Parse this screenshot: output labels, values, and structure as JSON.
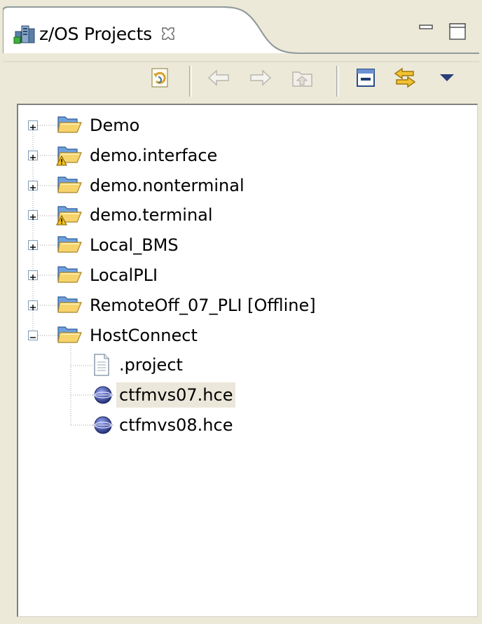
{
  "view": {
    "title": "z/OS Projects",
    "icon": "zos-projects-icon",
    "close_icon": "close-icon",
    "minimize_icon": "minimize-icon",
    "maximize_icon": "maximize-icon"
  },
  "toolbar": {
    "buttons": [
      {
        "name": "refresh-icon"
      },
      {
        "name": "back-arrow-icon",
        "disabled": true
      },
      {
        "name": "forward-arrow-icon",
        "disabled": true
      },
      {
        "name": "up-folder-icon",
        "disabled": true
      },
      {
        "name": "collapse-all-icon"
      },
      {
        "name": "link-with-editor-icon"
      },
      {
        "name": "view-menu-icon"
      }
    ]
  },
  "tree": {
    "items": [
      {
        "label": "Demo",
        "icon": "folder-icon",
        "expanded": false
      },
      {
        "label": "demo.interface",
        "icon": "folder-warning-icon",
        "expanded": false
      },
      {
        "label": "demo.nonterminal",
        "icon": "folder-icon",
        "expanded": false
      },
      {
        "label": "demo.terminal",
        "icon": "folder-warning-icon",
        "expanded": false
      },
      {
        "label": "Local_BMS",
        "icon": "folder-icon",
        "expanded": false
      },
      {
        "label": "LocalPLI",
        "icon": "folder-icon",
        "expanded": false
      },
      {
        "label": "RemoteOff_07_PLI [Offline]",
        "icon": "folder-icon",
        "expanded": false
      },
      {
        "label": "HostConnect",
        "icon": "folder-icon",
        "expanded": true
      },
      {
        "label": ".project",
        "icon": "text-file-icon",
        "child": true
      },
      {
        "label": "ctfmvs07.hce",
        "icon": "globe-icon",
        "child": true,
        "selected": true
      },
      {
        "label": "ctfmvs08.hce",
        "icon": "globe-icon",
        "child": true
      }
    ]
  },
  "colors": {
    "background": "#ece9d8",
    "tree_background": "#ffffff",
    "selection": "#ebe7da",
    "folder": "#f6d46b",
    "folder_blue": "#6fa0dc"
  }
}
